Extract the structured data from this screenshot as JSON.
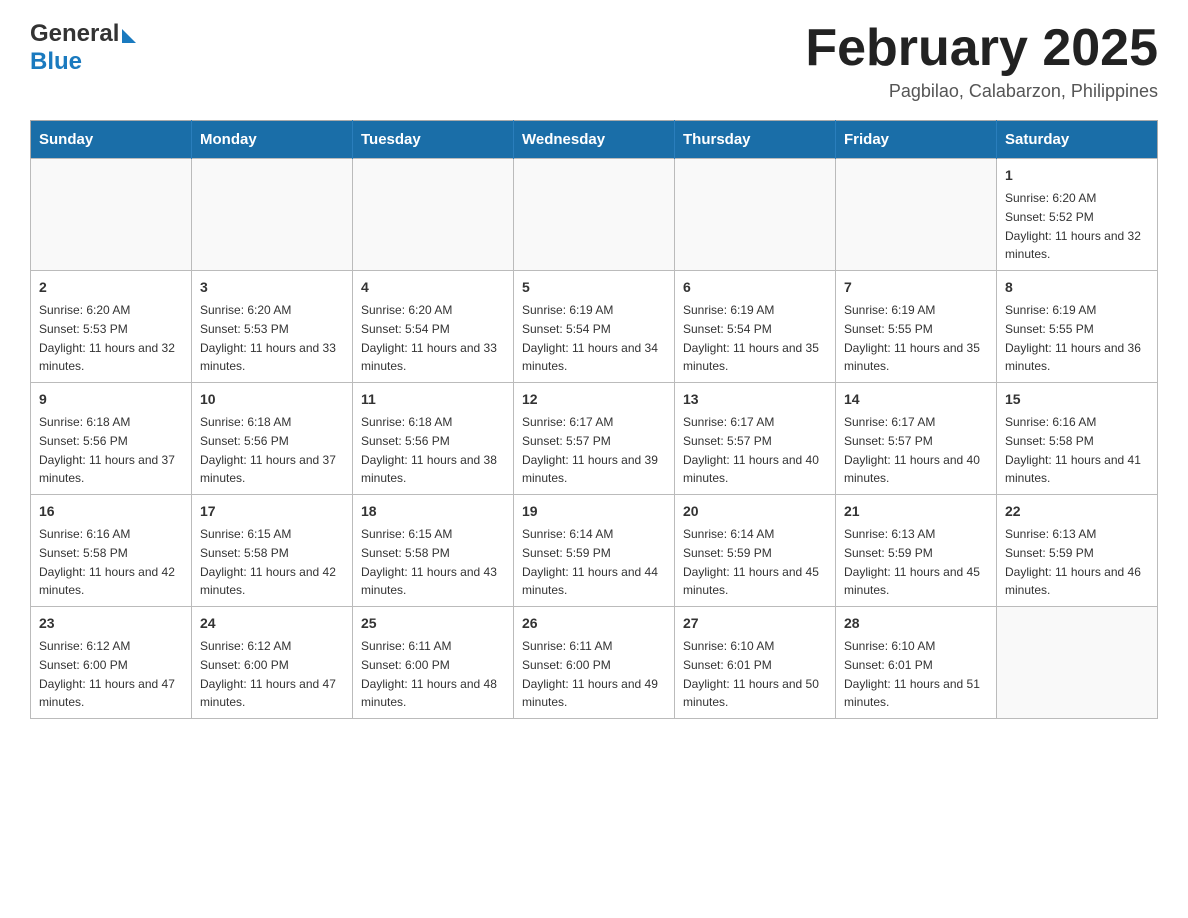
{
  "header": {
    "logo_general": "General",
    "logo_blue": "Blue",
    "main_title": "February 2025",
    "subtitle": "Pagbilao, Calabarzon, Philippines"
  },
  "calendar": {
    "days_of_week": [
      "Sunday",
      "Monday",
      "Tuesday",
      "Wednesday",
      "Thursday",
      "Friday",
      "Saturday"
    ],
    "weeks": [
      [
        {
          "day": "",
          "info": ""
        },
        {
          "day": "",
          "info": ""
        },
        {
          "day": "",
          "info": ""
        },
        {
          "day": "",
          "info": ""
        },
        {
          "day": "",
          "info": ""
        },
        {
          "day": "",
          "info": ""
        },
        {
          "day": "1",
          "info": "Sunrise: 6:20 AM\nSunset: 5:52 PM\nDaylight: 11 hours and 32 minutes."
        }
      ],
      [
        {
          "day": "2",
          "info": "Sunrise: 6:20 AM\nSunset: 5:53 PM\nDaylight: 11 hours and 32 minutes."
        },
        {
          "day": "3",
          "info": "Sunrise: 6:20 AM\nSunset: 5:53 PM\nDaylight: 11 hours and 33 minutes."
        },
        {
          "day": "4",
          "info": "Sunrise: 6:20 AM\nSunset: 5:54 PM\nDaylight: 11 hours and 33 minutes."
        },
        {
          "day": "5",
          "info": "Sunrise: 6:19 AM\nSunset: 5:54 PM\nDaylight: 11 hours and 34 minutes."
        },
        {
          "day": "6",
          "info": "Sunrise: 6:19 AM\nSunset: 5:54 PM\nDaylight: 11 hours and 35 minutes."
        },
        {
          "day": "7",
          "info": "Sunrise: 6:19 AM\nSunset: 5:55 PM\nDaylight: 11 hours and 35 minutes."
        },
        {
          "day": "8",
          "info": "Sunrise: 6:19 AM\nSunset: 5:55 PM\nDaylight: 11 hours and 36 minutes."
        }
      ],
      [
        {
          "day": "9",
          "info": "Sunrise: 6:18 AM\nSunset: 5:56 PM\nDaylight: 11 hours and 37 minutes."
        },
        {
          "day": "10",
          "info": "Sunrise: 6:18 AM\nSunset: 5:56 PM\nDaylight: 11 hours and 37 minutes."
        },
        {
          "day": "11",
          "info": "Sunrise: 6:18 AM\nSunset: 5:56 PM\nDaylight: 11 hours and 38 minutes."
        },
        {
          "day": "12",
          "info": "Sunrise: 6:17 AM\nSunset: 5:57 PM\nDaylight: 11 hours and 39 minutes."
        },
        {
          "day": "13",
          "info": "Sunrise: 6:17 AM\nSunset: 5:57 PM\nDaylight: 11 hours and 40 minutes."
        },
        {
          "day": "14",
          "info": "Sunrise: 6:17 AM\nSunset: 5:57 PM\nDaylight: 11 hours and 40 minutes."
        },
        {
          "day": "15",
          "info": "Sunrise: 6:16 AM\nSunset: 5:58 PM\nDaylight: 11 hours and 41 minutes."
        }
      ],
      [
        {
          "day": "16",
          "info": "Sunrise: 6:16 AM\nSunset: 5:58 PM\nDaylight: 11 hours and 42 minutes."
        },
        {
          "day": "17",
          "info": "Sunrise: 6:15 AM\nSunset: 5:58 PM\nDaylight: 11 hours and 42 minutes."
        },
        {
          "day": "18",
          "info": "Sunrise: 6:15 AM\nSunset: 5:58 PM\nDaylight: 11 hours and 43 minutes."
        },
        {
          "day": "19",
          "info": "Sunrise: 6:14 AM\nSunset: 5:59 PM\nDaylight: 11 hours and 44 minutes."
        },
        {
          "day": "20",
          "info": "Sunrise: 6:14 AM\nSunset: 5:59 PM\nDaylight: 11 hours and 45 minutes."
        },
        {
          "day": "21",
          "info": "Sunrise: 6:13 AM\nSunset: 5:59 PM\nDaylight: 11 hours and 45 minutes."
        },
        {
          "day": "22",
          "info": "Sunrise: 6:13 AM\nSunset: 5:59 PM\nDaylight: 11 hours and 46 minutes."
        }
      ],
      [
        {
          "day": "23",
          "info": "Sunrise: 6:12 AM\nSunset: 6:00 PM\nDaylight: 11 hours and 47 minutes."
        },
        {
          "day": "24",
          "info": "Sunrise: 6:12 AM\nSunset: 6:00 PM\nDaylight: 11 hours and 47 minutes."
        },
        {
          "day": "25",
          "info": "Sunrise: 6:11 AM\nSunset: 6:00 PM\nDaylight: 11 hours and 48 minutes."
        },
        {
          "day": "26",
          "info": "Sunrise: 6:11 AM\nSunset: 6:00 PM\nDaylight: 11 hours and 49 minutes."
        },
        {
          "day": "27",
          "info": "Sunrise: 6:10 AM\nSunset: 6:01 PM\nDaylight: 11 hours and 50 minutes."
        },
        {
          "day": "28",
          "info": "Sunrise: 6:10 AM\nSunset: 6:01 PM\nDaylight: 11 hours and 51 minutes."
        },
        {
          "day": "",
          "info": ""
        }
      ]
    ]
  }
}
